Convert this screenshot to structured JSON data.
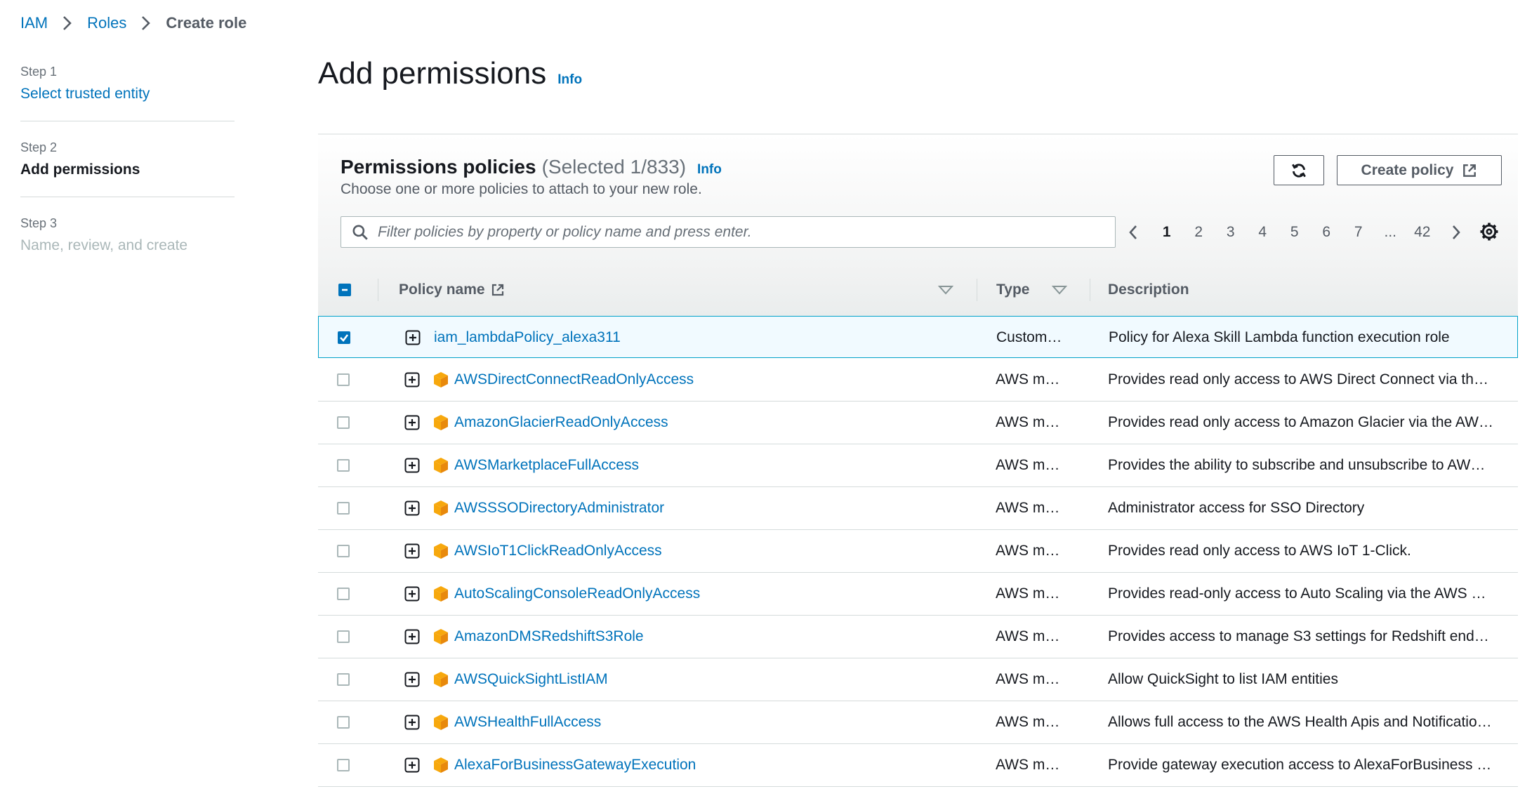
{
  "breadcrumb": {
    "items": [
      "IAM",
      "Roles"
    ],
    "current": "Create role"
  },
  "steps": [
    {
      "num": "Step 1",
      "title": "Select trusted entity"
    },
    {
      "num": "Step 2",
      "title": "Add permissions"
    },
    {
      "num": "Step 3",
      "title": "Name, review, and create"
    }
  ],
  "page": {
    "title": "Add permissions",
    "info": "Info"
  },
  "panel": {
    "title": "Permissions policies",
    "count": "(Selected 1/833)",
    "info": "Info",
    "description": "Choose one or more policies to attach to your new role.",
    "create_policy_label": "Create policy",
    "search_placeholder": "Filter policies by property or policy name and press enter."
  },
  "pagination": {
    "pages": [
      "1",
      "2",
      "3",
      "4",
      "5",
      "6",
      "7",
      "...",
      "42"
    ],
    "current": "1"
  },
  "table": {
    "columns": {
      "name": "Policy name",
      "type": "Type",
      "description": "Description"
    },
    "rows": [
      {
        "name": "iam_lambdaPolicy_alexa311",
        "type": "Custom…",
        "description": "Policy for Alexa Skill Lambda function execution role",
        "checked": true,
        "aws_managed": false
      },
      {
        "name": "AWSDirectConnectReadOnlyAccess",
        "type": "AWS m…",
        "description": "Provides read only access to AWS Direct Connect via th…",
        "checked": false,
        "aws_managed": true
      },
      {
        "name": "AmazonGlacierReadOnlyAccess",
        "type": "AWS m…",
        "description": "Provides read only access to Amazon Glacier via the AW…",
        "checked": false,
        "aws_managed": true
      },
      {
        "name": "AWSMarketplaceFullAccess",
        "type": "AWS m…",
        "description": "Provides the ability to subscribe and unsubscribe to AW…",
        "checked": false,
        "aws_managed": true
      },
      {
        "name": "AWSSSODirectoryAdministrator",
        "type": "AWS m…",
        "description": "Administrator access for SSO Directory",
        "checked": false,
        "aws_managed": true
      },
      {
        "name": "AWSIoT1ClickReadOnlyAccess",
        "type": "AWS m…",
        "description": "Provides read only access to AWS IoT 1-Click.",
        "checked": false,
        "aws_managed": true
      },
      {
        "name": "AutoScalingConsoleReadOnlyAccess",
        "type": "AWS m…",
        "description": "Provides read-only access to Auto Scaling via the AWS …",
        "checked": false,
        "aws_managed": true
      },
      {
        "name": "AmazonDMSRedshiftS3Role",
        "type": "AWS m…",
        "description": "Provides access to manage S3 settings for Redshift end…",
        "checked": false,
        "aws_managed": true
      },
      {
        "name": "AWSQuickSightListIAM",
        "type": "AWS m…",
        "description": "Allow QuickSight to list IAM entities",
        "checked": false,
        "aws_managed": true
      },
      {
        "name": "AWSHealthFullAccess",
        "type": "AWS m…",
        "description": "Allows full access to the AWS Health Apis and Notificatio…",
        "checked": false,
        "aws_managed": true
      },
      {
        "name": "AlexaForBusinessGatewayExecution",
        "type": "AWS m…",
        "description": "Provide gateway execution access to AlexaForBusiness …",
        "checked": false,
        "aws_managed": true
      }
    ]
  },
  "colors": {
    "link": "#0073bb",
    "aws_orange": "#f7a80d",
    "selected_row": "#f1faff",
    "selected_border": "#00a1c9"
  }
}
